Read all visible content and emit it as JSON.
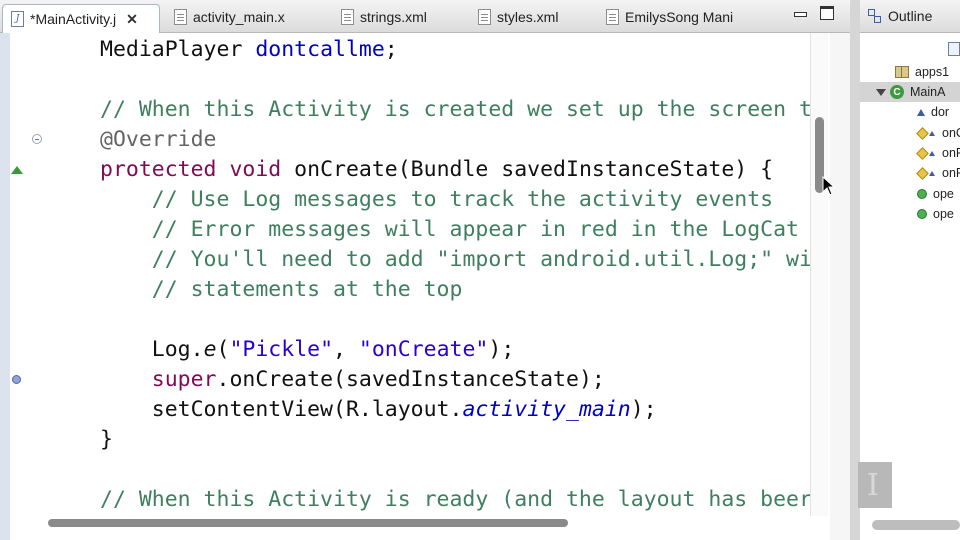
{
  "editor": {
    "tabs": [
      {
        "label": "*MainActivity.j",
        "icon": "java-file-icon",
        "active": true,
        "close": "✕"
      },
      {
        "label": "activity_main.x",
        "icon": "xml-file-icon"
      },
      {
        "label": "strings.xml",
        "icon": "xml-file-icon"
      },
      {
        "label": "styles.xml",
        "icon": "xml-file-icon"
      },
      {
        "label": "EmilysSong Mani",
        "icon": "xml-file-icon"
      }
    ],
    "window_controls": [
      "minimize-icon",
      "maximize-icon"
    ],
    "code_lines": [
      {
        "indent": "",
        "parts": [
          {
            "t": "MediaPlayer ",
            "c": ""
          },
          {
            "t": "dontcallme",
            "c": "fd"
          },
          {
            "t": ";",
            "c": ""
          }
        ]
      },
      {
        "indent": "",
        "parts": []
      },
      {
        "indent": "",
        "parts": [
          {
            "t": "// When this Activity is created we set up the screen t",
            "c": "cm"
          }
        ]
      },
      {
        "indent": "",
        "parts": [
          {
            "t": "@Override",
            "c": "an"
          }
        ]
      },
      {
        "indent": "",
        "parts": [
          {
            "t": "protected",
            "c": "kw"
          },
          {
            "t": " ",
            "c": ""
          },
          {
            "t": "void",
            "c": "kw"
          },
          {
            "t": " onCreate(Bundle savedInstanceState) {",
            "c": ""
          }
        ]
      },
      {
        "indent": "    ",
        "parts": [
          {
            "t": "// Use Log messages to track the activity events",
            "c": "cm"
          }
        ]
      },
      {
        "indent": "    ",
        "parts": [
          {
            "t": "// Error messages will appear in red in the LogCat",
            "c": "cm"
          }
        ]
      },
      {
        "indent": "    ",
        "parts": [
          {
            "t": "// You'll need to add \"import android.util.Log;\" wi",
            "c": "cm"
          }
        ]
      },
      {
        "indent": "    ",
        "parts": [
          {
            "t": "// statements at the top",
            "c": "cm"
          }
        ]
      },
      {
        "indent": "",
        "parts": []
      },
      {
        "indent": "    ",
        "parts": [
          {
            "t": "Log.",
            "c": ""
          },
          {
            "t": "e",
            "c": "it"
          },
          {
            "t": "(",
            "c": ""
          },
          {
            "t": "\"Pickle\"",
            "c": "st"
          },
          {
            "t": ", ",
            "c": ""
          },
          {
            "t": "\"onCreate\"",
            "c": "st"
          },
          {
            "t": ");",
            "c": ""
          }
        ]
      },
      {
        "indent": "    ",
        "parts": [
          {
            "t": "super",
            "c": "kw"
          },
          {
            "t": ".onCreate(savedInstanceState);",
            "c": ""
          }
        ]
      },
      {
        "indent": "    ",
        "parts": [
          {
            "t": "setContentView(R.layout.",
            "c": ""
          },
          {
            "t": "activity_main",
            "c": "fd it"
          },
          {
            "t": ");",
            "c": ""
          }
        ]
      },
      {
        "indent": "",
        "parts": [
          {
            "t": "}",
            "c": ""
          }
        ]
      },
      {
        "indent": "",
        "parts": []
      },
      {
        "indent": "",
        "parts": [
          {
            "t": "// When this Activity is ready (and the layout has beer",
            "c": "cm"
          }
        ]
      }
    ]
  },
  "outline": {
    "title": "Outline",
    "items": [
      {
        "label": "apps1",
        "icon": "package-icon",
        "kind": "package"
      },
      {
        "label": "MainA",
        "icon": "class-icon",
        "kind": "class",
        "selected": true
      },
      {
        "label": "dor",
        "icon": "field-icon",
        "kind": "field"
      },
      {
        "label": "onC",
        "icon": "protected-method-icon",
        "kind": "prot"
      },
      {
        "label": "onR",
        "icon": "protected-method-icon",
        "kind": "prot"
      },
      {
        "label": "onP",
        "icon": "protected-method-icon",
        "kind": "prot"
      },
      {
        "label": "ope",
        "icon": "public-method-icon",
        "kind": "pub"
      },
      {
        "label": "ope",
        "icon": "public-method-icon",
        "kind": "pub"
      }
    ]
  },
  "colors": {
    "keyword": "#7f0a55",
    "comment": "#3f7f5f",
    "string": "#2a00d2",
    "field": "#0000c0",
    "annotation": "#646464"
  }
}
